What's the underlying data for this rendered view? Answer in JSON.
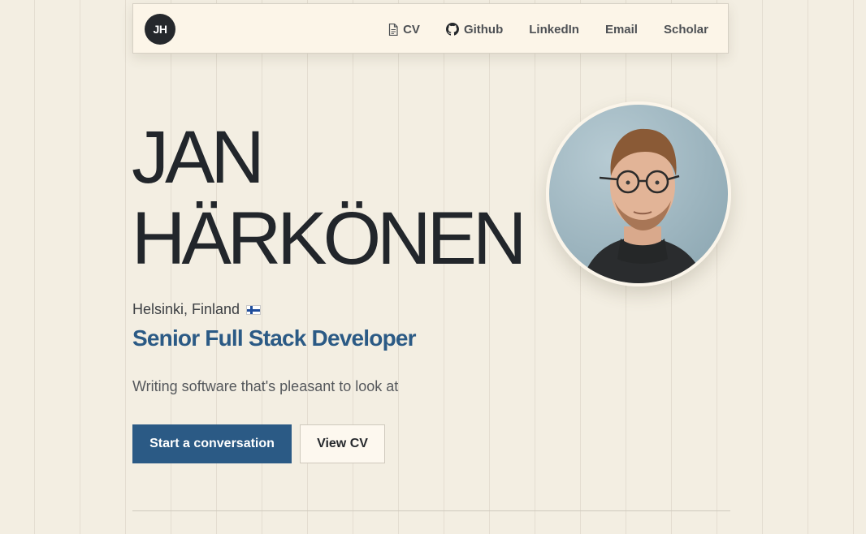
{
  "nav": {
    "logo_initials": "JH",
    "links": [
      {
        "label": "CV",
        "icon": "document-icon"
      },
      {
        "label": "Github",
        "icon": "github-icon"
      },
      {
        "label": "LinkedIn"
      },
      {
        "label": "Email"
      },
      {
        "label": "Scholar"
      }
    ]
  },
  "hero": {
    "first_name": "JAN",
    "last_name": "HÄRKÖNEN",
    "location": "Helsinki, Finland",
    "location_flag": "finland-flag-icon",
    "role": "Senior Full Stack Developer",
    "tagline": "Writing software that's pleasant to look at",
    "primary_button": "Start a conversation",
    "secondary_button": "View CV",
    "portrait": "profile-photo"
  },
  "colors": {
    "background": "#f3eee2",
    "nav_background": "#fcf5e8",
    "accent": "#2b5a85",
    "text": "#22262b"
  }
}
